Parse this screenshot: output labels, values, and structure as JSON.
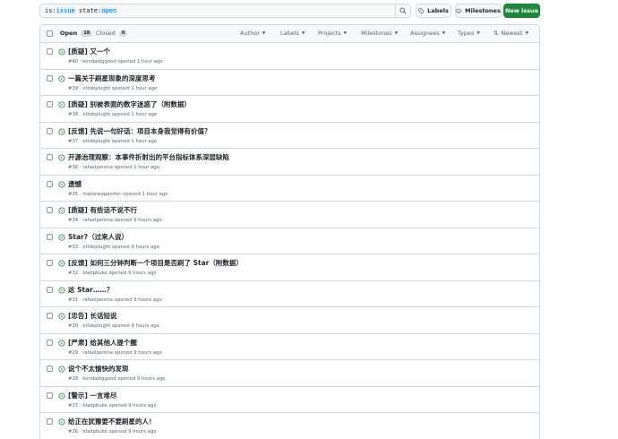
{
  "search": {
    "key1": "is:",
    "val1": "issue",
    "key2": " state:",
    "val2": "open"
  },
  "toolbar": {
    "labels": "Labels",
    "milestones": "Milestones",
    "new_issue": "New issue"
  },
  "header": {
    "open_label": "Open",
    "open_count": "18",
    "closed_label": "Closed",
    "closed_count": "0",
    "filters": {
      "author": "Author",
      "labels": "Labels",
      "projects": "Projects",
      "milestones": "Milestones",
      "assignees": "Assignees",
      "types": "Types",
      "sort": "Newest"
    }
  },
  "colors": {
    "accent": "#0969da",
    "open_green": "#1a7f37",
    "new_button": "#1f883d"
  },
  "issues": [
    {
      "title": "[质疑] 又一个",
      "meta": "#40 · kendadiggood opened 1 hour ago"
    },
    {
      "title": "一篇关于刷星现象的深度思考",
      "meta": "#39 · ettdeplught opened 1 hour ago"
    },
    {
      "title": "[质疑] 别被表面的数字迷惑了（附数据）",
      "meta": "#38 · ettdeplught opened 1 hour ago"
    },
    {
      "title": "[反馈] 先说一句好话：项目本身我觉得有价值？",
      "meta": "#37 · ettdeplught opened 1 hour ago"
    },
    {
      "title": "开源治理观察：本事件折射出的平台指标体系深层缺陷",
      "meta": "#36 · rafaelperena opened 1 hour ago"
    },
    {
      "title": "遗憾",
      "meta": "#35 · matarwapporter opened 1 hour ago"
    },
    {
      "title": "[质疑] 有些话不说不行",
      "meta": "#34 · rafaelperena opened 9 hours ago"
    },
    {
      "title": "Star?（过来人说）",
      "meta": "#33 · ettdeplught opened 9 hours ago"
    },
    {
      "title": "[反馈] 如何三分钟判断一个项目是否刷了 Star（附数据）",
      "meta": "#32 · bladpbuke opened 9 hours ago"
    },
    {
      "title": "这 Star……？",
      "meta": "#31 · rafaelperena opened 9 hours ago"
    },
    {
      "title": "[忠告] 长话短说",
      "meta": "#30 · ettdeplught opened 9 hours ago"
    },
    {
      "title": "[严肃] 给其他人提个醒",
      "meta": "#29 · rafaelperena opened 9 hours ago"
    },
    {
      "title": "说个不太愉快的发现",
      "meta": "#28 · kendadiggood opened 9 hours ago"
    },
    {
      "title": "[警示] 一言难尽",
      "meta": "#27 · bladpbuke opened 9 hours ago"
    },
    {
      "title": "给正在犹豫要不要刷星的人！",
      "meta": "#26 · bladpbuke opened 9 hours ago"
    }
  ]
}
